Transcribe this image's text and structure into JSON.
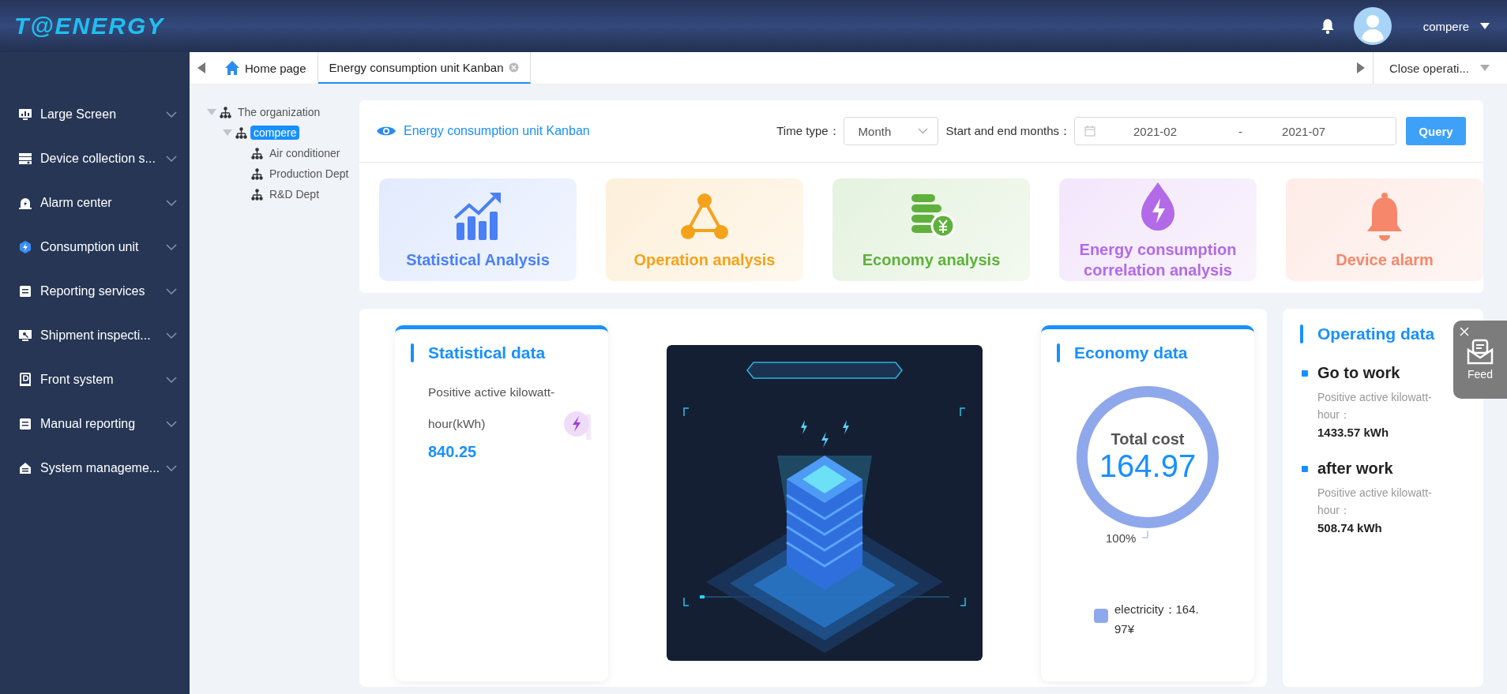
{
  "header": {
    "logo": "T@ENERGY",
    "user": "compere"
  },
  "sidebar": {
    "items": [
      {
        "label": "Large Screen"
      },
      {
        "label": "Device collection s..."
      },
      {
        "label": "Alarm center"
      },
      {
        "label": "Consumption unit"
      },
      {
        "label": "Reporting services"
      },
      {
        "label": "Shipment inspecti..."
      },
      {
        "label": "Front system"
      },
      {
        "label": "Manual reporting"
      },
      {
        "label": "System manageme..."
      }
    ]
  },
  "tabs": [
    {
      "label": "Home page",
      "kind": "home",
      "selected": false
    },
    {
      "label": "Energy consumption unit Kanban",
      "kind": "closable",
      "selected": true
    }
  ],
  "close_operations": "Close operati...",
  "tree": [
    {
      "label": "The organization",
      "expanded": true,
      "selected": false,
      "children": [
        {
          "label": "compere",
          "expanded": true,
          "selected": true,
          "children": [
            {
              "label": "Air conditioner",
              "selected": false
            },
            {
              "label": "Production Dept",
              "selected": false
            },
            {
              "label": "R&D Dept",
              "selected": false
            }
          ]
        }
      ]
    }
  ],
  "toolbar": {
    "title": "Energy consumption unit Kanban",
    "time_type_label": "Time type：",
    "time_type": "Month",
    "range_label": "Start and end months：",
    "start": "2021-02",
    "separator": "-",
    "end": "2021-07",
    "query": "Query"
  },
  "categories": [
    {
      "label": "Statistical Analysis",
      "color": "#4a7ff5"
    },
    {
      "label": "Operation analysis",
      "color": "#f5a21b"
    },
    {
      "label": "Economy analysis",
      "color": "#5fb13c"
    },
    {
      "label": "Energy consumption correlation analysis",
      "color": "#b26ae8"
    },
    {
      "label": "Device alarm",
      "color": "#f6876a"
    }
  ],
  "statistical": {
    "title": "Statistical data",
    "label": "Positive active kilowatt-hour(kWh)",
    "value": "840.25"
  },
  "economy": {
    "title": "Economy data",
    "center_label": "Total cost",
    "center_value": "164.97",
    "percent_label": "100%",
    "legend": "electricity：164.97¥"
  },
  "operating": {
    "title": "Operating data",
    "entries": [
      {
        "name": "Go to work",
        "label": "Positive active kilowatt-hour：",
        "value": "1433.57 kWh"
      },
      {
        "name": "after work",
        "label": "Positive active kilowatt-hour：",
        "value": "508.74 kWh"
      }
    ]
  },
  "feed": {
    "label": "Feed"
  }
}
